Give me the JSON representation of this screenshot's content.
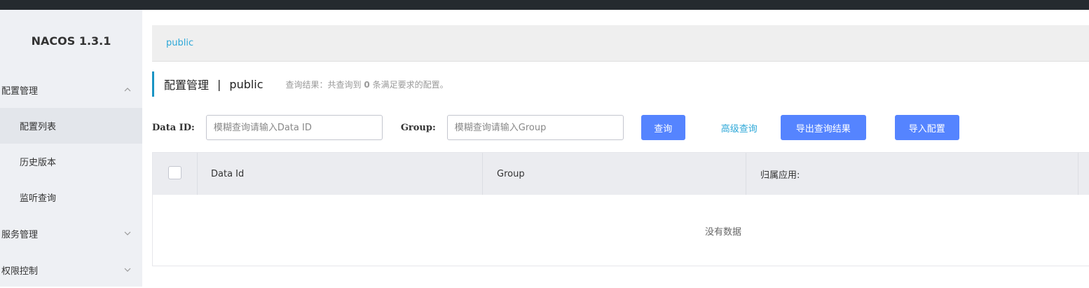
{
  "brand": {
    "title": "NACOS 1.3.1"
  },
  "sidebar": {
    "groups": [
      {
        "label": "配置管理",
        "expanded": true,
        "items": [
          {
            "label": "配置列表",
            "active": true
          },
          {
            "label": "历史版本",
            "active": false
          },
          {
            "label": "监听查询",
            "active": false
          }
        ]
      },
      {
        "label": "服务管理",
        "expanded": false
      },
      {
        "label": "权限控制",
        "expanded": false
      }
    ]
  },
  "namespace_bar": {
    "current": "public"
  },
  "header": {
    "title": "配置管理",
    "separator": "|",
    "namespace": "public",
    "result_prefix": "查询结果：共查询到",
    "result_count": "0",
    "result_suffix": "条满足要求的配置。"
  },
  "filters": {
    "data_id_label": "Data ID:",
    "data_id_placeholder": "模糊查询请输入Data ID",
    "group_label": "Group:",
    "group_placeholder": "模糊查询请输入Group",
    "query_button": "查询",
    "advanced_query": "高级查询",
    "export_button": "导出查询结果",
    "import_button": "导入配置"
  },
  "table": {
    "columns": [
      "Data Id",
      "Group",
      "归属应用:"
    ],
    "empty_text": "没有数据",
    "rows": []
  },
  "colors": {
    "topbar": "#252a2f",
    "sidebar_bg": "#eef0f4",
    "primary_button": "#5584ff",
    "link": "#2ea8d8"
  }
}
